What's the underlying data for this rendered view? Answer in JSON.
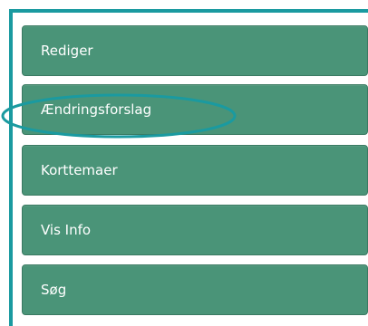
{
  "menu": {
    "items": [
      {
        "label": "Rediger"
      },
      {
        "label": "Ændringsforslag"
      },
      {
        "label": "Korttemaer"
      },
      {
        "label": "Vis Info"
      },
      {
        "label": "Søg"
      }
    ]
  },
  "colors": {
    "frame_accent": "#1a9aa0",
    "button_bg": "#4a9478",
    "button_text": "#ffffff",
    "highlight_ring": "#1a9aa0"
  }
}
